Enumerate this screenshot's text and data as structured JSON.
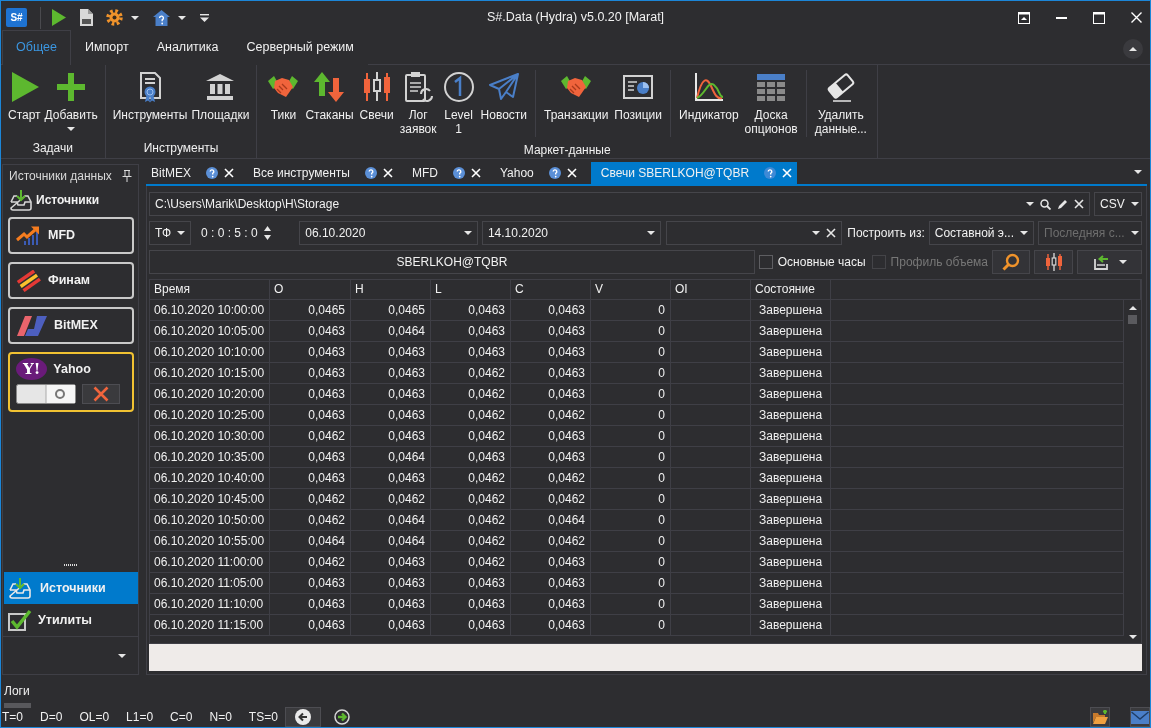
{
  "window": {
    "logo": "S#",
    "title": "S#.Data (Hydra) v5.0.20 [Marat]"
  },
  "ribbon": {
    "tabs": [
      {
        "label": "Общее",
        "selected": true
      },
      {
        "label": "Импорт",
        "selected": false
      },
      {
        "label": "Аналитика",
        "selected": false
      },
      {
        "label": "Серверный режим",
        "selected": false
      }
    ],
    "groups": [
      {
        "caption": "Задачи",
        "sections": [
          {
            "buttons": [
              {
                "label": "Старт"
              },
              {
                "label": "Добавить",
                "dropdown": true
              }
            ]
          }
        ]
      },
      {
        "caption": "Инструменты",
        "sections": [
          {
            "buttons": [
              {
                "label": "Инструменты"
              },
              {
                "label": "Площадки"
              }
            ]
          }
        ]
      },
      {
        "caption": "Маркет-данные",
        "sections": [
          {
            "buttons": [
              {
                "label": "Тики"
              },
              {
                "label": "Стаканы"
              },
              {
                "label": "Свечи"
              },
              {
                "label": "Лог\nзаявок"
              },
              {
                "label": "Level\n1"
              },
              {
                "label": "Новости"
              }
            ]
          },
          {
            "buttons": [
              {
                "label": "Транзакции"
              },
              {
                "label": "Позиции"
              }
            ]
          },
          {
            "buttons": [
              {
                "label": "Индикатор"
              },
              {
                "label": "Доска\nопционов"
              }
            ]
          },
          {
            "buttons": [
              {
                "label": "Удалить\nданные..."
              }
            ]
          }
        ]
      }
    ]
  },
  "sources_panel": {
    "title": "Источники данных",
    "section": "Источники",
    "sources": [
      {
        "name": "MFD",
        "selected": false
      },
      {
        "name": "Финам",
        "selected": false
      },
      {
        "name": "BitMEX",
        "selected": false
      },
      {
        "name": "Yahoo",
        "logo": "Y!",
        "selected": true,
        "on": false
      }
    ]
  },
  "nav": [
    {
      "label": "Источники",
      "selected": true
    },
    {
      "label": "Утилиты",
      "selected": false
    }
  ],
  "doc_tabs": [
    {
      "label": "BitMEX",
      "selected": false
    },
    {
      "label": "Все инструменты",
      "selected": false
    },
    {
      "label": "MFD",
      "selected": false
    },
    {
      "label": "Yahoo",
      "selected": false
    },
    {
      "label": "Свечи SBERLKOH@TQBR",
      "selected": true
    }
  ],
  "toolbar": {
    "storage_path": "C:\\Users\\Marik\\Desktop\\H\\Storage",
    "format": "CSV",
    "timeframe_label": "ТФ",
    "timeframe": "0 : 0 : 5 : 0",
    "from_date": "06.10.2020",
    "to_date": "14.10.2020",
    "build_from_label": "Построить из:",
    "build_from": "Составной э...",
    "build_value": {
      "text": "Последняя с...",
      "disabled": true
    },
    "security": "SBERLKOH@TQBR",
    "checkboxes": [
      {
        "label": "Основные часы",
        "checked": false,
        "disabled": false
      },
      {
        "label": "Профиль объема",
        "checked": false,
        "disabled": true
      }
    ]
  },
  "table": {
    "columns": [
      "Время",
      "O",
      "H",
      "L",
      "C",
      "V",
      "OI",
      "Состояние"
    ],
    "rows": [
      {
        "time": "06.10.2020 10:00:00",
        "o": "0,0465",
        "h": "0,0465",
        "l": "0,0463",
        "c": "0,0463",
        "v": "0",
        "state": "Завершена"
      },
      {
        "time": "06.10.2020 10:05:00",
        "o": "0,0463",
        "h": "0,0464",
        "l": "0,0463",
        "c": "0,0463",
        "v": "0",
        "state": "Завершена"
      },
      {
        "time": "06.10.2020 10:10:00",
        "o": "0,0463",
        "h": "0,0463",
        "l": "0,0463",
        "c": "0,0463",
        "v": "0",
        "state": "Завершена"
      },
      {
        "time": "06.10.2020 10:15:00",
        "o": "0,0463",
        "h": "0,0463",
        "l": "0,0462",
        "c": "0,0463",
        "v": "0",
        "state": "Завершена"
      },
      {
        "time": "06.10.2020 10:20:00",
        "o": "0,0463",
        "h": "0,0463",
        "l": "0,0462",
        "c": "0,0463",
        "v": "0",
        "state": "Завершена"
      },
      {
        "time": "06.10.2020 10:25:00",
        "o": "0,0463",
        "h": "0,0463",
        "l": "0,0462",
        "c": "0,0462",
        "v": "0",
        "state": "Завершена"
      },
      {
        "time": "06.10.2020 10:30:00",
        "o": "0,0462",
        "h": "0,0463",
        "l": "0,0462",
        "c": "0,0463",
        "v": "0",
        "state": "Завершена"
      },
      {
        "time": "06.10.2020 10:35:00",
        "o": "0,0463",
        "h": "0,0464",
        "l": "0,0463",
        "c": "0,0463",
        "v": "0",
        "state": "Завершена"
      },
      {
        "time": "06.10.2020 10:40:00",
        "o": "0,0463",
        "h": "0,0463",
        "l": "0,0462",
        "c": "0,0462",
        "v": "0",
        "state": "Завершена"
      },
      {
        "time": "06.10.2020 10:45:00",
        "o": "0,0462",
        "h": "0,0462",
        "l": "0,0462",
        "c": "0,0462",
        "v": "0",
        "state": "Завершена"
      },
      {
        "time": "06.10.2020 10:50:00",
        "o": "0,0462",
        "h": "0,0464",
        "l": "0,0462",
        "c": "0,0464",
        "v": "0",
        "state": "Завершена"
      },
      {
        "time": "06.10.2020 10:55:00",
        "o": "0,0464",
        "h": "0,0464",
        "l": "0,0462",
        "c": "0,0462",
        "v": "0",
        "state": "Завершена"
      },
      {
        "time": "06.10.2020 11:00:00",
        "o": "0,0462",
        "h": "0,0463",
        "l": "0,0462",
        "c": "0,0463",
        "v": "0",
        "state": "Завершена"
      },
      {
        "time": "06.10.2020 11:05:00",
        "o": "0,0463",
        "h": "0,0463",
        "l": "0,0463",
        "c": "0,0463",
        "v": "0",
        "state": "Завершена"
      },
      {
        "time": "06.10.2020 11:10:00",
        "o": "0,0463",
        "h": "0,0463",
        "l": "0,0463",
        "c": "0,0463",
        "v": "0",
        "state": "Завершена"
      },
      {
        "time": "06.10.2020 11:15:00",
        "o": "0,0463",
        "h": "0,0463",
        "l": "0,0463",
        "c": "0,0463",
        "v": "0",
        "state": "Завершена"
      }
    ]
  },
  "logs": {
    "title": "Логи"
  },
  "status_bar": {
    "counters": [
      "T=0",
      "D=0",
      "OL=0",
      "L1=0",
      "C=0",
      "N=0",
      "TS=0"
    ]
  }
}
